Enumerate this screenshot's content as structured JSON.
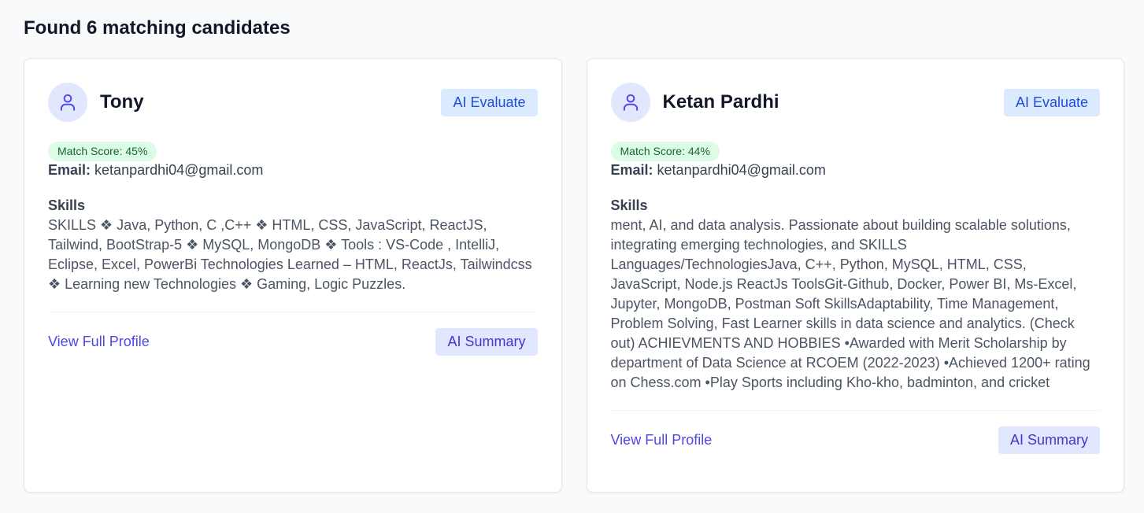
{
  "results": {
    "title": "Found 6 matching candidates"
  },
  "colors": {
    "accent": "#4f46e5",
    "evaluate_bg": "#dbeafe",
    "summary_bg": "#e0e7ff",
    "score_bg": "#dcfce7",
    "score_text": "#166534"
  },
  "candidates": [
    {
      "name": "Tony",
      "avatar_icon": "user-icon",
      "evaluate_label": "AI Evaluate",
      "match_score": "Match Score: 45%",
      "email_label": "Email:",
      "email": "ketanpardhi04@gmail.com",
      "skills_heading": "Skills",
      "skills": "SKILLS ❖ Java, Python, C ,C++ ❖ HTML, CSS, JavaScript, ReactJS, Tailwind, BootStrap-5 ❖ MySQL, MongoDB ❖ Tools : VS-Code , IntelliJ, Eclipse, Excel, PowerBi Technologies Learned – HTML, ReactJs, Tailwindcss ❖ Learning new Technologies ❖ Gaming, Logic Puzzles.",
      "profile_link": "View Full Profile",
      "summary_label": "AI Summary"
    },
    {
      "name": "Ketan Pardhi",
      "avatar_icon": "user-icon",
      "evaluate_label": "AI Evaluate",
      "match_score": "Match Score: 44%",
      "email_label": "Email:",
      "email": "ketanpardhi04@gmail.com",
      "skills_heading": "Skills",
      "skills": "ment, AI, and data analysis. Passionate about building scalable solutions, integrating emerging technologies, and SKILLS Languages/TechnologiesJava, C++, Python, MySQL, HTML, CSS, JavaScript, Node.js ReactJs ToolsGit-Github, Docker, Power BI, Ms-Excel, Jupyter, MongoDB, Postman Soft SkillsAdaptability, Time Management, Problem Solving, Fast Learner skills in data science and analytics. (Check out) ACHIEVMENTS AND HOBBIES •Awarded with Merit Scholarship by department of Data Science at RCOEM (2022-2023) •Achieved 1200+ rating on Chess.com •Play Sports including Kho-kho, badminton, and cricket",
      "profile_link": "View Full Profile",
      "summary_label": "AI Summary"
    }
  ]
}
